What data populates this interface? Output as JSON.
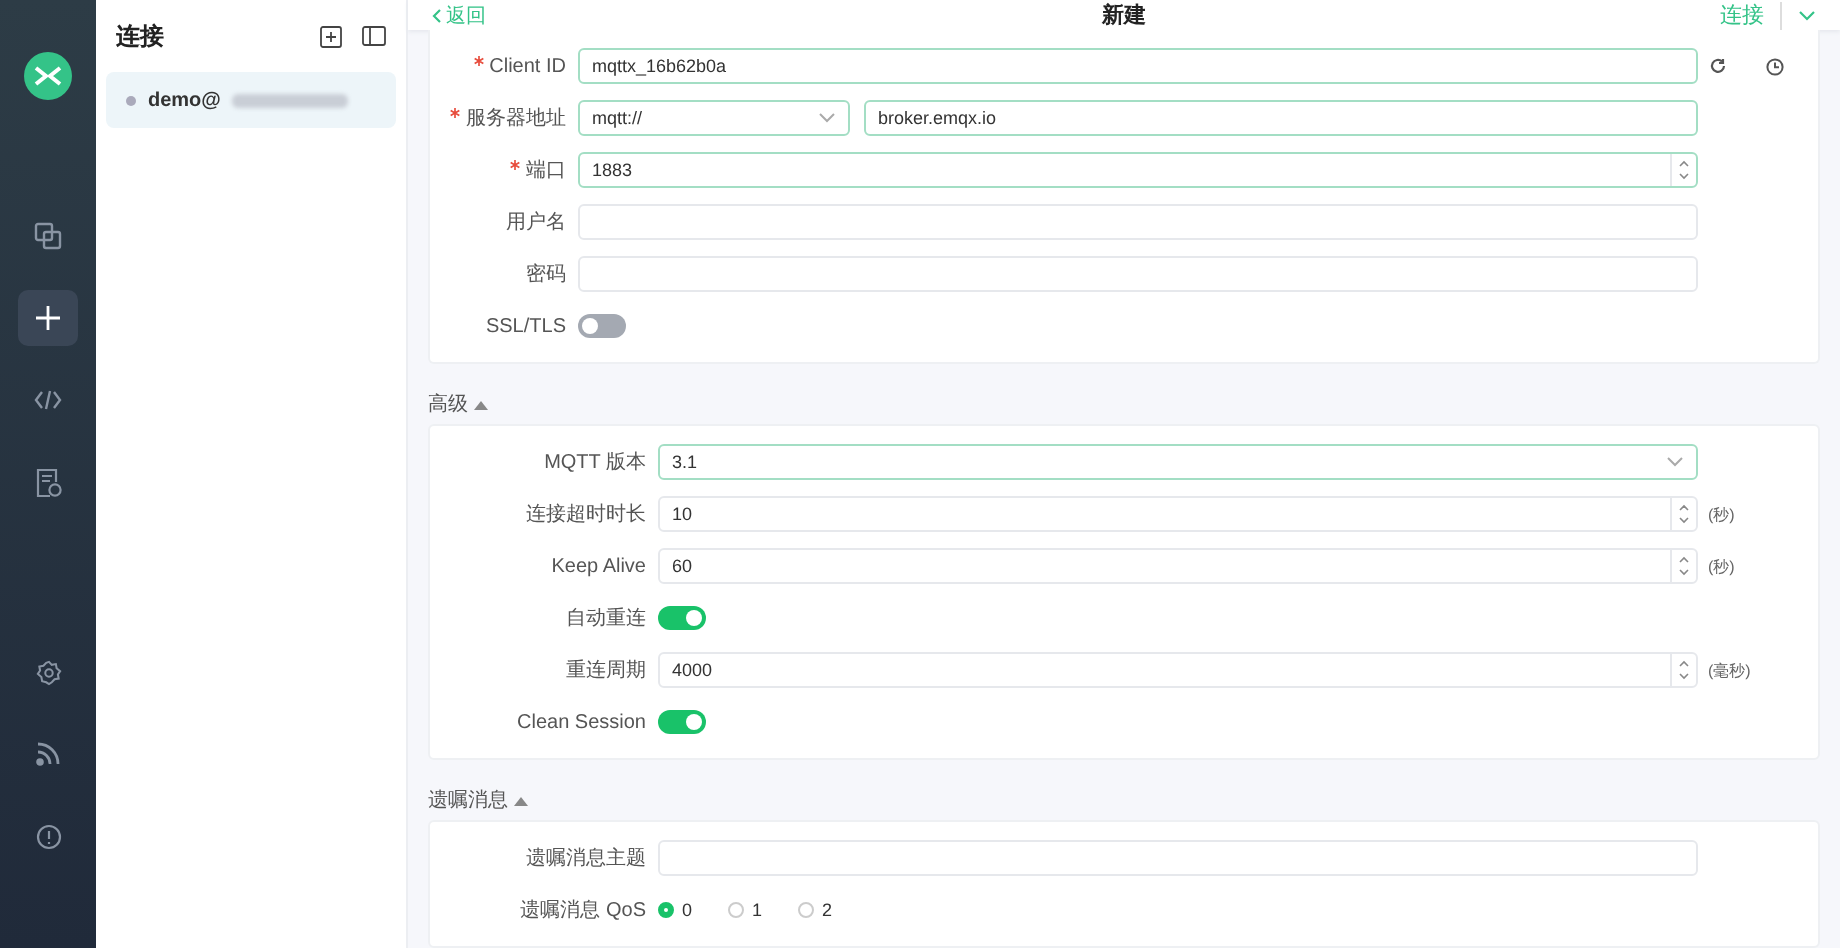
{
  "nav": [
    {
      "kind": "connections",
      "selected": false
    },
    {
      "kind": "new",
      "selected": true
    },
    {
      "kind": "script",
      "selected": false
    },
    {
      "kind": "log",
      "selected": false
    },
    {
      "kind": "settings",
      "selected": false
    },
    {
      "kind": "feed",
      "selected": false
    },
    {
      "kind": "about",
      "selected": false
    }
  ],
  "sidebar": {
    "title": "连接",
    "connections": [
      {
        "name": "demo@",
        "selected": true
      }
    ]
  },
  "header": {
    "back": "返回",
    "title": "新建",
    "connect": "连接"
  },
  "general": {
    "fields": [
      {
        "kind": "id",
        "label": "Client ID",
        "required": true,
        "highlighted": true,
        "value": "mqttx_16b62b0a"
      },
      {
        "kind": "address",
        "label": "服务器地址",
        "required": true,
        "highlighted": true,
        "protocol": "mqtt://",
        "value": "broker.emqx.io"
      },
      {
        "kind": "number",
        "label": "端口",
        "required": true,
        "highlighted": true,
        "value": "1883"
      },
      {
        "kind": "text",
        "label": "用户名",
        "required": false,
        "highlighted": false
      },
      {
        "kind": "text",
        "label": "密码",
        "required": false,
        "highlighted": false
      },
      {
        "kind": "switch",
        "label": "SSL/TLS",
        "on": false
      }
    ]
  },
  "advanced": {
    "title": "高级",
    "expanded": true,
    "fields": [
      {
        "kind": "select",
        "label": "MQTT 版本",
        "highlighted": true,
        "value": "3.1"
      },
      {
        "kind": "number",
        "label": "连接超时时长",
        "highlighted": false,
        "value": "10",
        "unit": "(秒)"
      },
      {
        "kind": "number",
        "label": "Keep Alive",
        "highlighted": false,
        "value": "60",
        "unit": "(秒)"
      },
      {
        "kind": "switch",
        "label": "自动重连",
        "on": true
      },
      {
        "kind": "number",
        "label": "重连周期",
        "highlighted": false,
        "value": "4000",
        "unit": "(毫秒)"
      },
      {
        "kind": "switch",
        "label": "Clean Session",
        "on": true
      }
    ]
  },
  "will": {
    "title": "遗嘱消息",
    "expanded": true,
    "fields": [
      {
        "kind": "text",
        "label": "遗嘱消息主题",
        "highlighted": false
      },
      {
        "kind": "radio",
        "label": "遗嘱消息 QoS",
        "options": [
          {
            "label": "0",
            "selected": true
          },
          {
            "label": "1",
            "selected": false
          },
          {
            "label": "2",
            "selected": false
          }
        ]
      }
    ]
  }
}
